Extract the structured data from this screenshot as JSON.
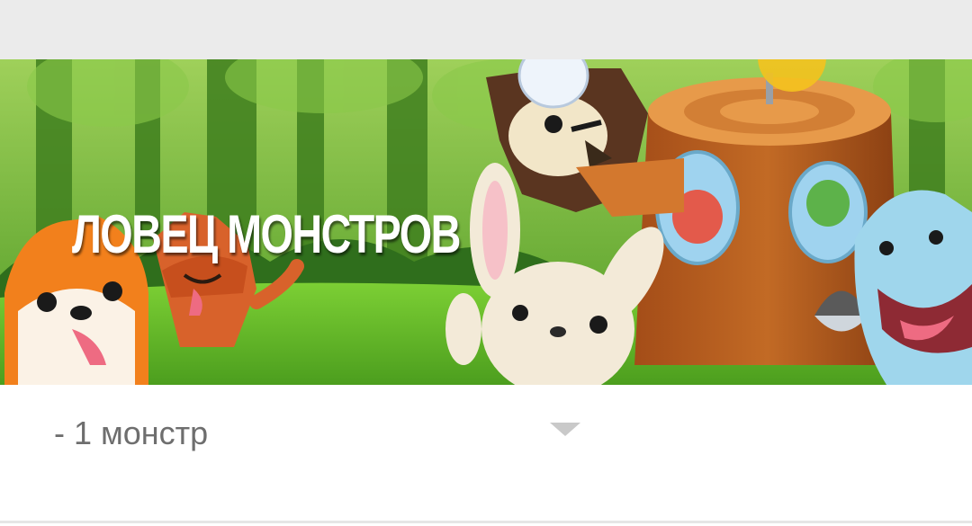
{
  "banner": {
    "title": "ЛОВЕЦ МОНСТРОВ",
    "image_description_icon": "monster-catcher-game-art"
  },
  "selector": {
    "value": "- 1 монстр",
    "chevron_icon": "chevron-down-icon"
  },
  "colors": {
    "topbar": "#ebebeb",
    "forest_dark": "#2f6e1c",
    "grass": "#6bbf2a",
    "stump": "#b25a1e",
    "select_text": "#6e6e6e",
    "chevron": "#c9c9c9"
  }
}
